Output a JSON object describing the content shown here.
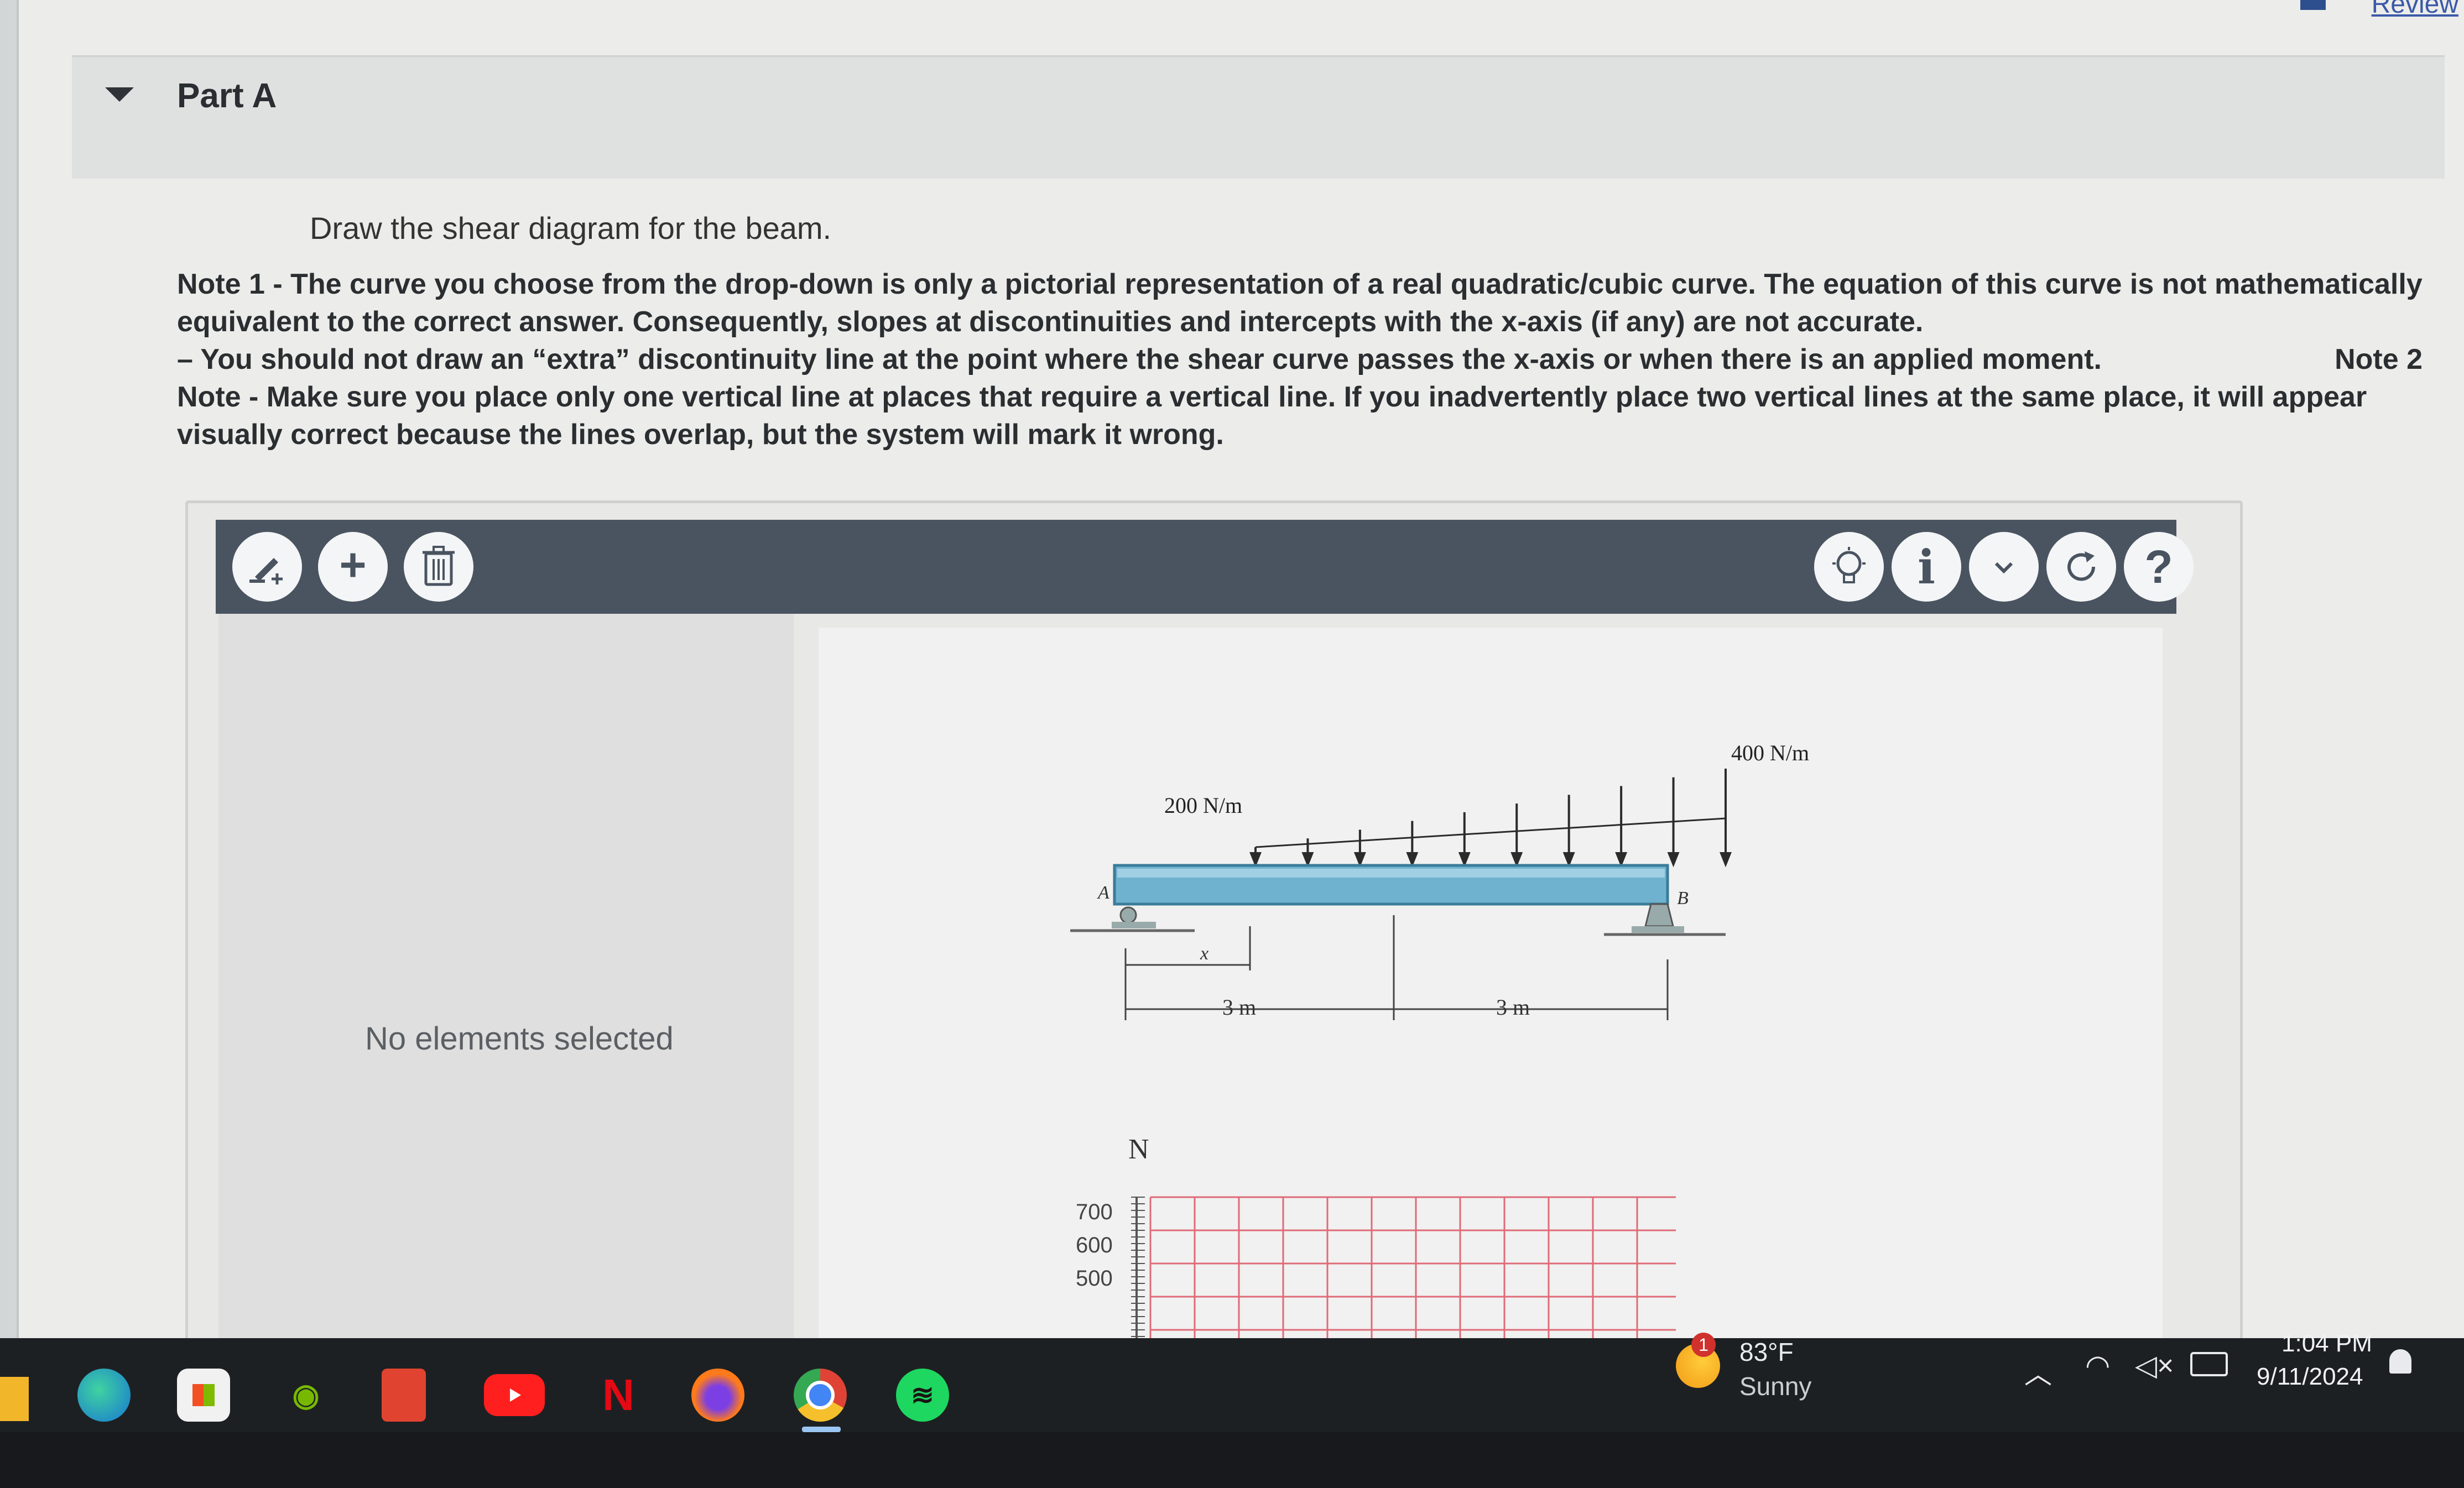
{
  "header": {
    "review_link": "Review"
  },
  "part": {
    "title": "Part A"
  },
  "question": {
    "prompt": "Draw the shear diagram for the beam."
  },
  "notes": {
    "note1": "Note 1 - The curve you choose from the drop-down is only a pictorial representation of a real quadratic/cubic curve. The equation of this curve is not mathematically equivalent to the correct answer. Consequently, slopes at discontinuities and intercepts with the x-axis (if any) are not accurate.",
    "note2_label": "Note 2",
    "note2_text": "– You should not draw an “extra” discontinuity line at the point where the shear curve passes the x-axis or when there is an applied moment.",
    "note3": "Note - Make sure you place only one vertical line at places that require a vertical line. If you inadvertently place two vertical lines at the same place, it will appear visually correct because the lines overlap, but the system will mark it wrong."
  },
  "toolbar": {
    "left_buttons": [
      {
        "name": "draw-tool-button",
        "icon": "pencil-plus-icon"
      },
      {
        "name": "add-button",
        "icon": "plus-icon",
        "glyph": "+"
      },
      {
        "name": "delete-button",
        "icon": "trash-icon"
      }
    ],
    "right_buttons": [
      {
        "name": "hint-button",
        "icon": "lightbulb-icon"
      },
      {
        "name": "info-button",
        "icon": "info-icon",
        "glyph": "i"
      },
      {
        "name": "dropdown-button",
        "icon": "chevron-down-icon"
      },
      {
        "name": "reset-button",
        "icon": "refresh-icon"
      },
      {
        "name": "help-button",
        "icon": "question-icon",
        "glyph": "?"
      }
    ]
  },
  "side_panel": {
    "status": "No elements selected"
  },
  "beam_figure": {
    "load_left": "200 N/m",
    "load_right": "400 N/m",
    "support_a": "A",
    "support_b": "B",
    "x_label": "x",
    "span1": "3 m",
    "span2": "3 m"
  },
  "graph": {
    "y_unit": "N",
    "y_ticks": [
      "700",
      "600",
      "500"
    ]
  },
  "taskbar": {
    "apps": [
      "edge-icon",
      "store-icon",
      "nvidia-icon",
      "office-icon",
      "youtube-icon",
      "netflix-icon",
      "firefox-icon",
      "chrome-icon",
      "spotify-icon"
    ],
    "weather_badge": "1",
    "weather_temp": "83°F",
    "weather_condition": "Sunny",
    "time": "1:04 PM",
    "date": "9/11/2024"
  },
  "colors": {
    "toolbar": "#4a5461",
    "beam": "#6fb2cf",
    "grid": "#e06a78",
    "taskbar": "#1d2023"
  }
}
